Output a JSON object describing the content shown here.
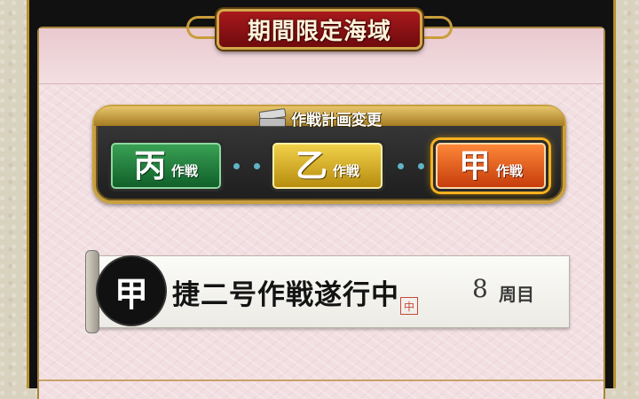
{
  "title": "期間限定海域",
  "plan": {
    "title": "作戦計画変更",
    "icon": "document-stack-icon",
    "difficulties": [
      {
        "key": "丙",
        "suffix": "作戦",
        "color": "#1f7a3a",
        "selected": false
      },
      {
        "key": "乙",
        "suffix": "作戦",
        "color": "#c99d12",
        "selected": false
      },
      {
        "key": "甲",
        "suffix": "作戦",
        "color": "#e05a14",
        "selected": true
      }
    ]
  },
  "operation": {
    "seal_char": "甲",
    "status": "捷二号作戦遂行中",
    "stamp": "中",
    "loop_count": "8",
    "loop_unit": "周目"
  }
}
